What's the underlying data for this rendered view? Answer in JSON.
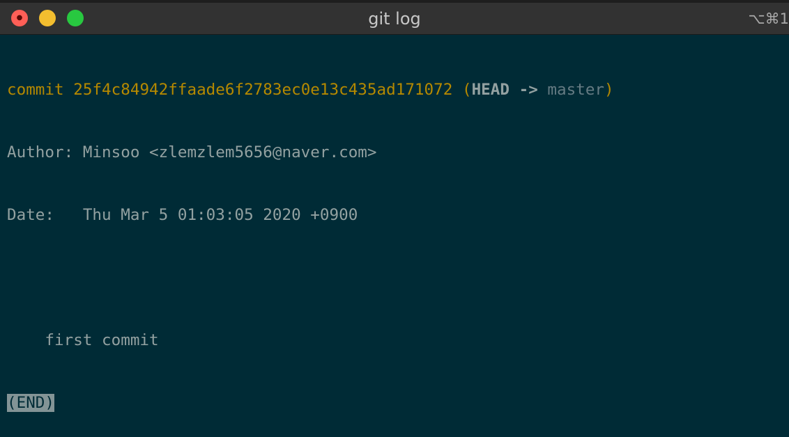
{
  "window": {
    "title": "git log",
    "shortcut": "⌥⌘1"
  },
  "log": {
    "commit_label": "commit",
    "commit_hash": "25f4c84942ffaade6f2783ec0e13c435ad171072",
    "paren_open": "(",
    "head": "HEAD",
    "arrow": "->",
    "branch": "master",
    "paren_close": ")",
    "author_line": "Author: Minsoo <zlemzlem5656@naver.com>",
    "date_line": "Date:   Thu Mar 5 01:03:05 2020 +0900",
    "message": "    first commit",
    "pager_end": "(END)"
  },
  "colors": {
    "background": "#002b36",
    "commit_yellow": "#b58900",
    "text_grey": "#93a1a1",
    "branch_grey": "#657b83"
  }
}
